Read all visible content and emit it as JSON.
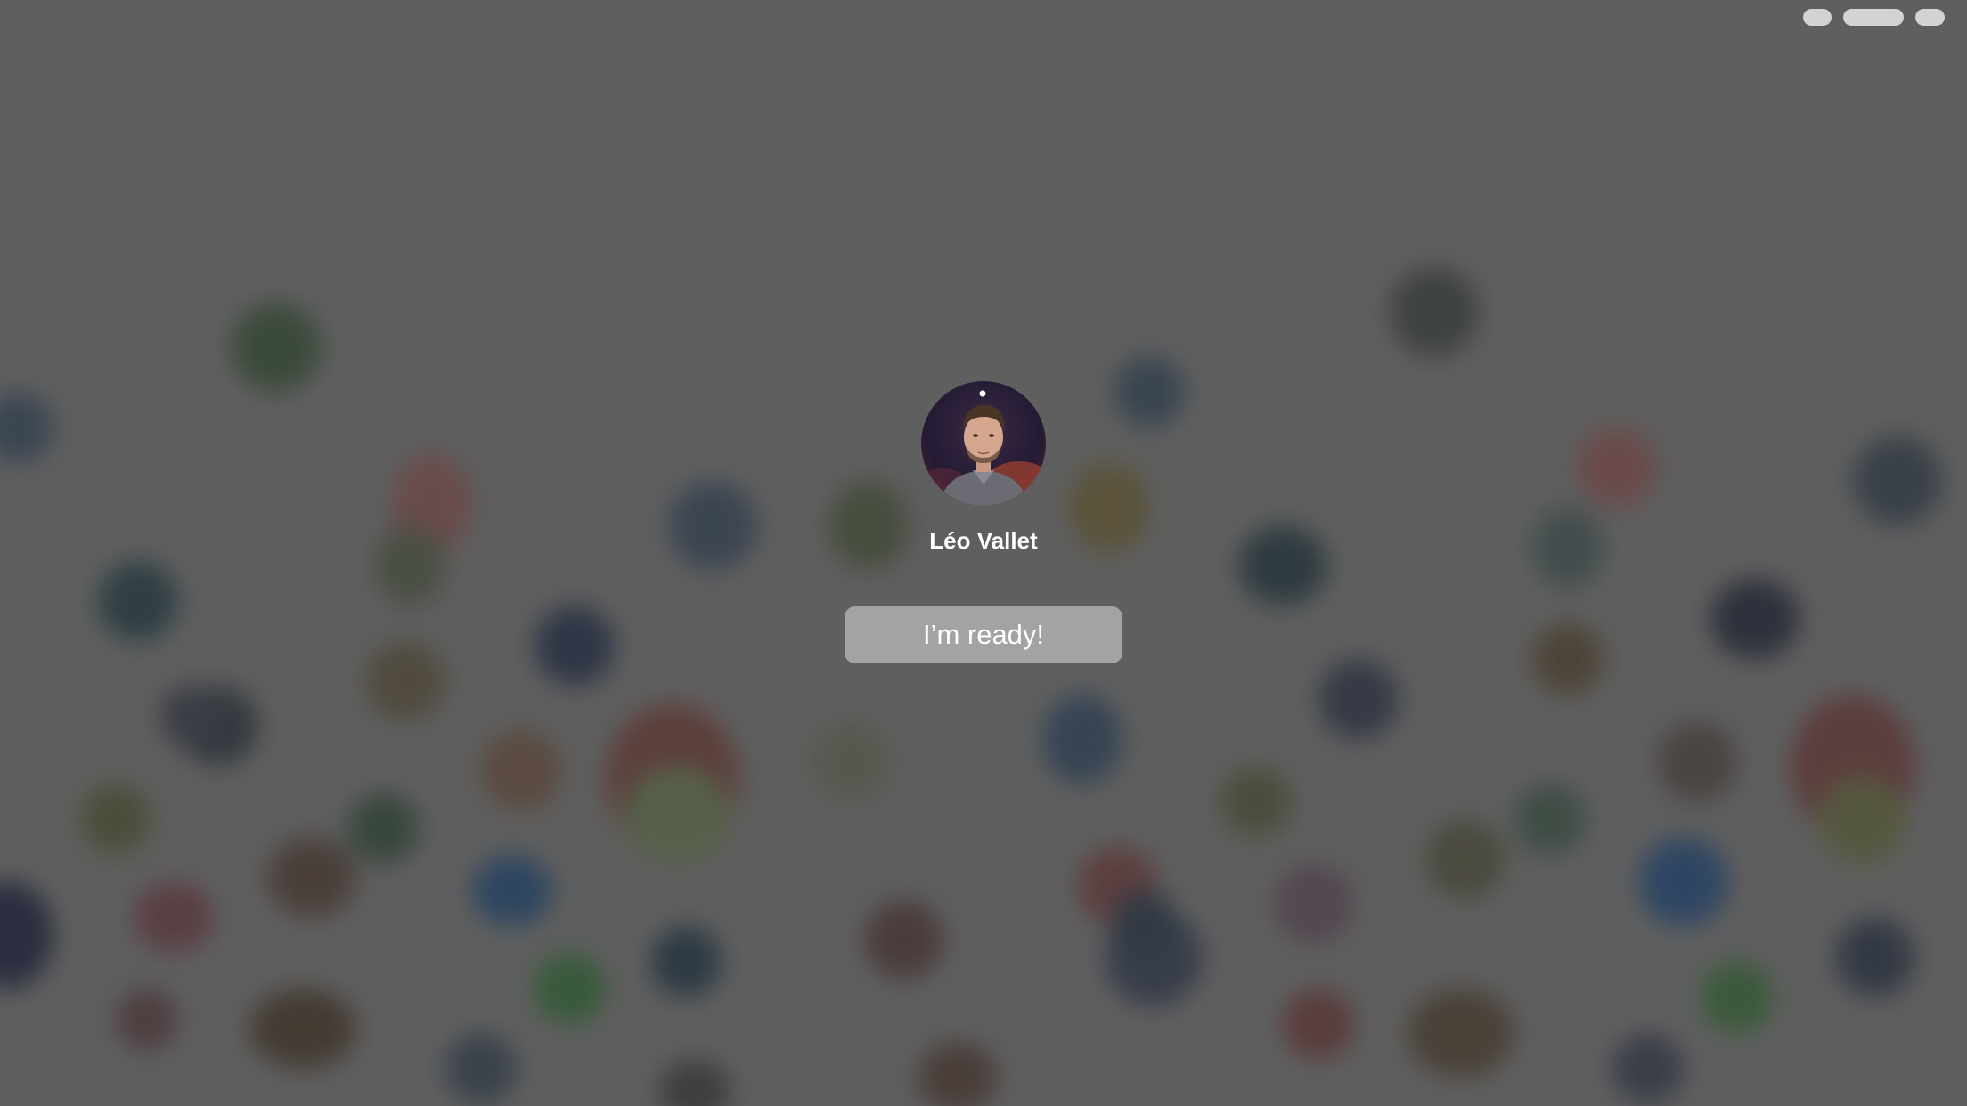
{
  "user": {
    "name": "Léo Vallet",
    "avatar_icon": "user-photo"
  },
  "ready_button": {
    "label": "I’m ready!"
  },
  "status_bar": {
    "items": [
      "status-indicator",
      "status-indicator",
      "status-indicator"
    ]
  },
  "colors": {
    "background": "#5f5f5f",
    "button": "#a3a3a3",
    "text": "#ffffff",
    "status_pill": "#d3d3d3"
  }
}
